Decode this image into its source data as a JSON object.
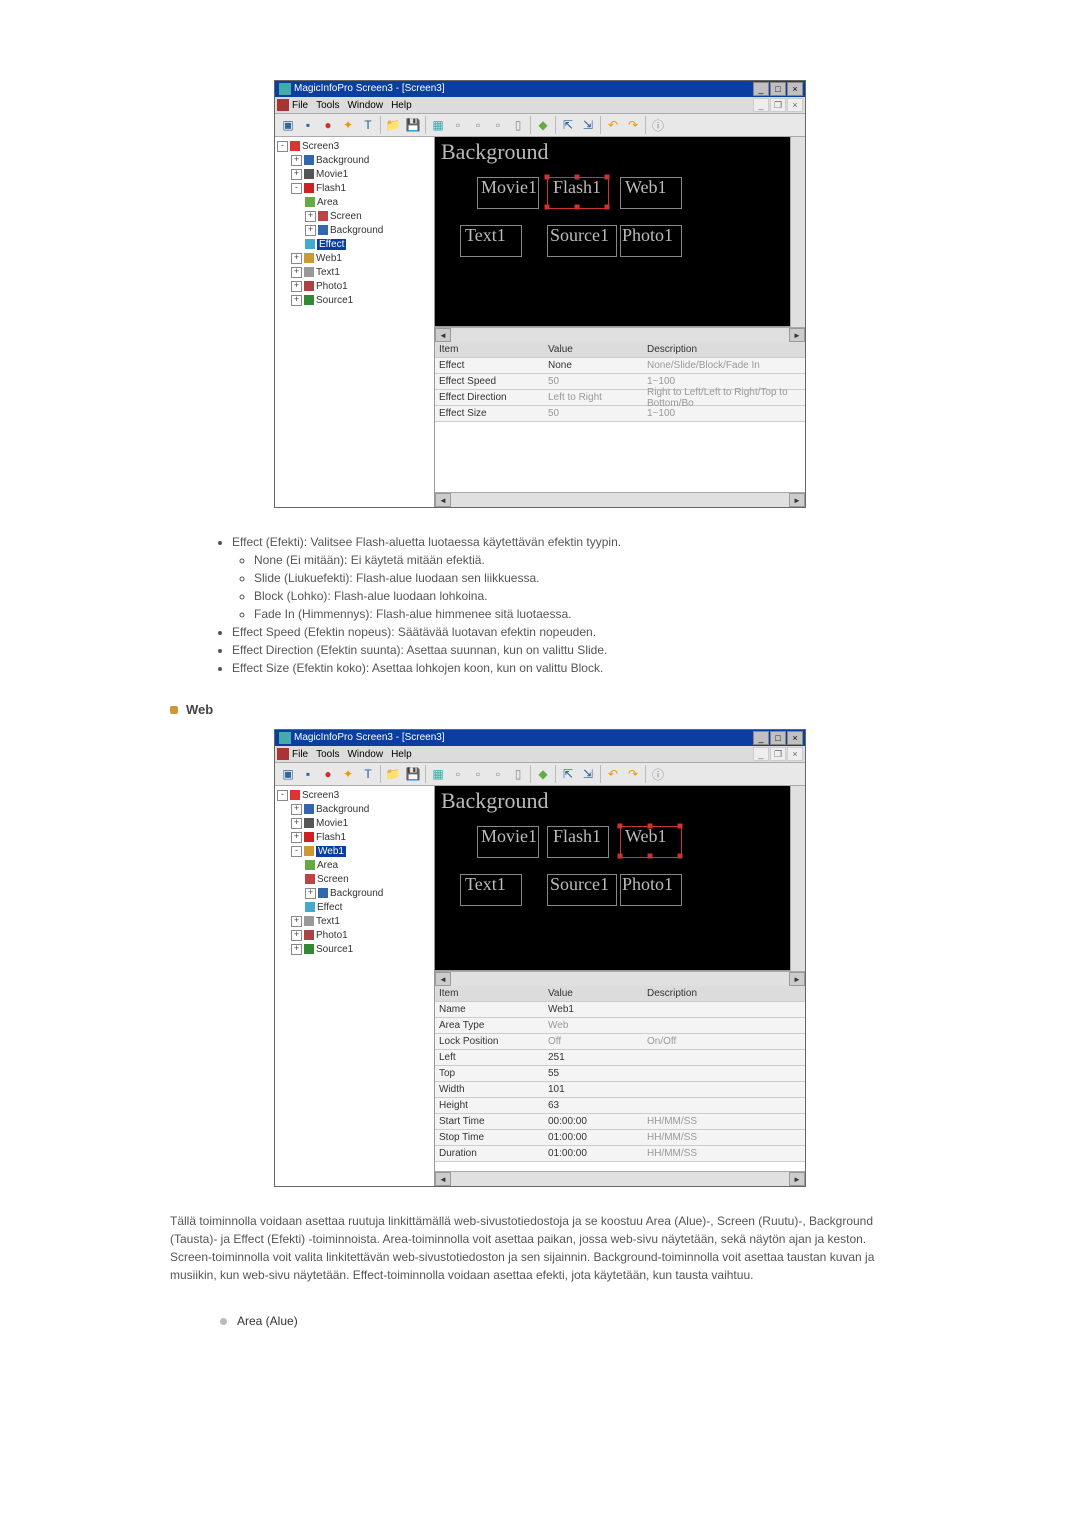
{
  "app1": {
    "title": "MagicInfoPro Screen3 - [Screen3]",
    "menu": [
      "File",
      "Tools",
      "Window",
      "Help"
    ],
    "canvas": {
      "bg_label": "Background",
      "boxes": [
        "Movie1",
        "Flash1",
        "Web1",
        "Text1",
        "Source1",
        "Photo1"
      ],
      "selected": "Flash1"
    },
    "tree": {
      "root": "Screen3",
      "children": [
        "Background",
        "Movie1",
        "Flash1",
        "Web1",
        "Text1",
        "Photo1",
        "Source1"
      ],
      "flash_children": [
        "Area",
        "Screen",
        "Background",
        "Effect"
      ],
      "selected": "Effect"
    },
    "grid": {
      "headers": [
        "Item",
        "Value",
        "Description"
      ],
      "rows": [
        {
          "item": "Effect",
          "value": "None",
          "desc": "None/Slide/Block/Fade In"
        },
        {
          "item": "Effect Speed",
          "value": "50",
          "desc": "1~100",
          "dim": true
        },
        {
          "item": "Effect Direction",
          "value": "Left to Right",
          "desc": "Right to Left/Left to Right/Top to Bottom/Bo",
          "dim": true
        },
        {
          "item": "Effect Size",
          "value": "50",
          "desc": "1~100",
          "dim": true
        }
      ]
    }
  },
  "doc1": {
    "items": [
      {
        "text": "Effect (Efekti): Valitsee Flash-aluetta luotaessa käytettävän efektin tyypin.",
        "subitems": [
          "None (Ei mitään): Ei käytetä mitään efektiä.",
          "Slide (Liukuefekti): Flash-alue luodaan sen liikkuessa.",
          "Block (Lohko): Flash-alue luodaan lohkoina.",
          "Fade In (Himmennys): Flash-alue himmenee sitä luotaessa."
        ]
      },
      {
        "text": "Effect Speed (Efektin nopeus): Säätävää luotavan efektin nopeuden."
      },
      {
        "text": "Effect Direction (Efektin suunta): Asettaa suunnan, kun on valittu Slide."
      },
      {
        "text": "Effect Size (Efektin koko): Asettaa lohkojen koon, kun on valittu Block."
      }
    ]
  },
  "web_heading": "Web",
  "app2": {
    "title": "MagicInfoPro Screen3 - [Screen3]",
    "menu": [
      "File",
      "Tools",
      "Window",
      "Help"
    ],
    "canvas": {
      "bg_label": "Background",
      "boxes": [
        "Movie1",
        "Flash1",
        "Web1",
        "Text1",
        "Source1",
        "Photo1"
      ],
      "selected": "Web1"
    },
    "tree": {
      "root": "Screen3",
      "children": [
        "Background",
        "Movie1",
        "Flash1",
        "Web1",
        "Text1",
        "Photo1",
        "Source1"
      ],
      "web_children": [
        "Area",
        "Screen",
        "Background",
        "Effect"
      ],
      "selected": "Web1"
    },
    "grid": {
      "headers": [
        "Item",
        "Value",
        "Description"
      ],
      "rows": [
        {
          "item": "Name",
          "value": "Web1",
          "desc": ""
        },
        {
          "item": "Area Type",
          "value": "Web",
          "desc": "",
          "dim": true
        },
        {
          "item": "Lock Position",
          "value": "Off",
          "desc": "On/Off",
          "dim": true
        },
        {
          "item": "Left",
          "value": "251",
          "desc": ""
        },
        {
          "item": "Top",
          "value": "55",
          "desc": ""
        },
        {
          "item": "Width",
          "value": "101",
          "desc": ""
        },
        {
          "item": "Height",
          "value": "63",
          "desc": ""
        },
        {
          "item": "Start Time",
          "value": "00:00:00",
          "desc": "HH/MM/SS",
          "dimdesc": true
        },
        {
          "item": "Stop Time",
          "value": "01:00:00",
          "desc": "HH/MM/SS",
          "dimdesc": true
        },
        {
          "item": "Duration",
          "value": "01:00:00",
          "desc": "HH/MM/SS",
          "dimdesc": true
        }
      ]
    }
  },
  "para": "Tällä toiminnolla voidaan asettaa ruutuja linkittämällä web-sivustotiedostoja ja se koostuu Area (Alue)-, Screen (Ruutu)-, Background (Tausta)- ja Effect (Efekti) -toiminnoista. Area-toiminnolla voit asettaa paikan, jossa web-sivu näytetään, sekä näytön ajan ja keston. Screen-toiminnolla voit valita linkitettävän web-sivustotiedoston ja sen sijainnin. Background-toiminnolla voit asettaa taustan kuvan ja musiikin, kun web-sivu näytetään. Effect-toiminnolla voidaan asettaa efekti, jota käytetään, kun tausta vaihtuu.",
  "sub_area": "Area (Alue)"
}
